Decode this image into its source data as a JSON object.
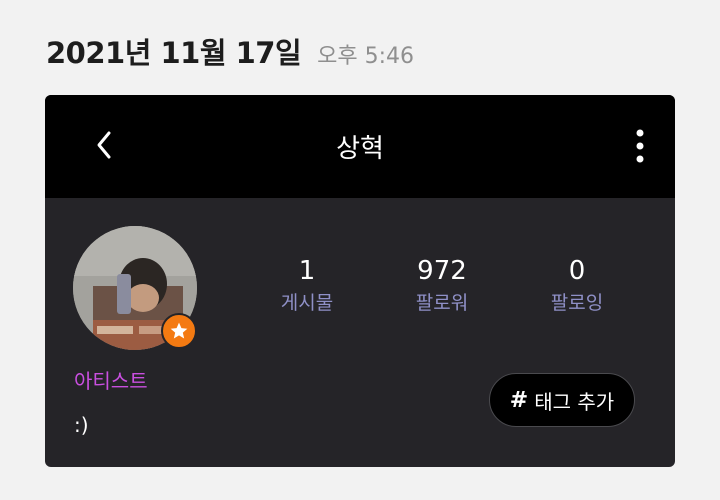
{
  "header": {
    "date": "2021년 11월 17일",
    "time": "오후 5:46"
  },
  "profile": {
    "title": "상혁",
    "back_icon": "chevron-left-icon",
    "more_icon": "vertical-dots-icon",
    "badge_icon": "star-icon",
    "stats": [
      {
        "value": "1",
        "label": "게시물"
      },
      {
        "value": "972",
        "label": "팔로워"
      },
      {
        "value": "0",
        "label": "팔로잉"
      }
    ],
    "role": "아티스트",
    "bio": ":)",
    "tag_button": {
      "hash": "#",
      "label": "태그 추가"
    }
  },
  "colors": {
    "background": "#f2f2f2",
    "topbar": "#000000",
    "card": "#252428",
    "stat_label": "#8f90c7",
    "role": "#c94fe0",
    "badge": "#f47a12"
  }
}
